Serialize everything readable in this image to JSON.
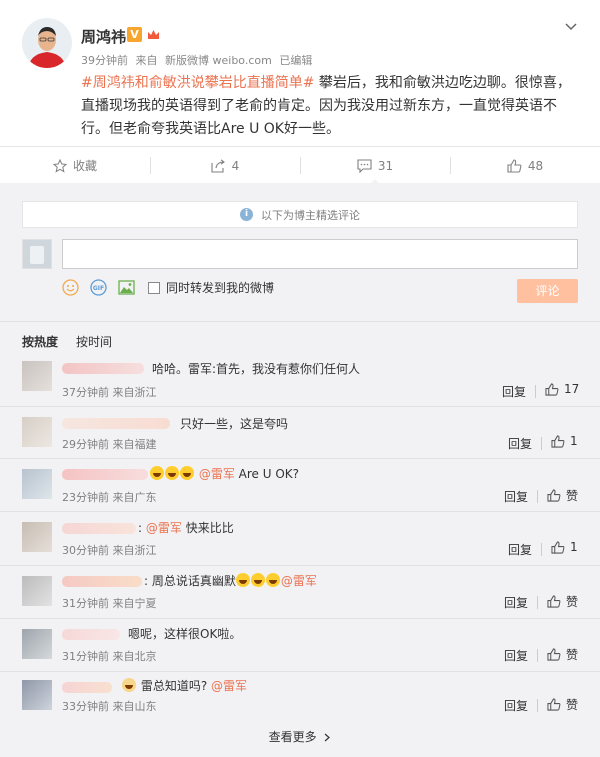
{
  "post": {
    "author": "周鸿祎",
    "verified_badge": "V",
    "meta": {
      "time": "39分钟前",
      "source_prefix": "来自",
      "source": "新版微博 weibo.com",
      "edited": "已编辑"
    },
    "topic": "#周鸿祎和俞敏洪说攀岩比直播简单#",
    "text": "攀岩后，我和俞敏洪边吃边聊。很惊喜，直播现场我的英语得到了老俞的肯定。因为我没用过新东方，一直觉得英语不行。但老俞夸我英语比Are U OK好一些。"
  },
  "actions": {
    "favorite": "收藏",
    "repost": "4",
    "comment": "31",
    "like": "48"
  },
  "comments_panel": {
    "notice": "以下为博主精选评论",
    "input_placeholder": "",
    "forward_label": "同时转发到我的微博",
    "submit_label": "评论",
    "sort_hot": "按热度",
    "sort_time": "按时间",
    "reply_label": "回复",
    "like_label": "赞",
    "more_label": "查看更多"
  },
  "comments": [
    {
      "text": "哈哈。雷军:首先，我没有惹你们任何人",
      "time": "37分钟前",
      "source": "来自浙江",
      "likes": "17"
    },
    {
      "text": "只好一些，这是夸吗",
      "time": "29分钟前",
      "source": "来自福建",
      "likes": "1"
    },
    {
      "mention": "@雷军",
      "text": " Are U OK?",
      "time": "23分钟前",
      "source": "来自广东",
      "likes": "赞"
    },
    {
      "mention": "@雷军",
      "text": " 快来比比",
      "time": "30分钟前",
      "source": "来自浙江",
      "likes": "1"
    },
    {
      "text": "周总说话真幽默",
      "mention": "@雷军",
      "time": "31分钟前",
      "source": "来自宁夏",
      "likes": "赞"
    },
    {
      "text": "嗯呢，这样很OK啦。",
      "time": "31分钟前",
      "source": "来自北京",
      "likes": "赞"
    },
    {
      "text": "雷总知道吗?",
      "mention": "@雷军",
      "time": "33分钟前",
      "source": "来自山东",
      "likes": "赞"
    }
  ],
  "colors": {
    "accent": "#eb7350",
    "submit": "#ffc09f",
    "panel_bg": "#f2f2f5"
  }
}
